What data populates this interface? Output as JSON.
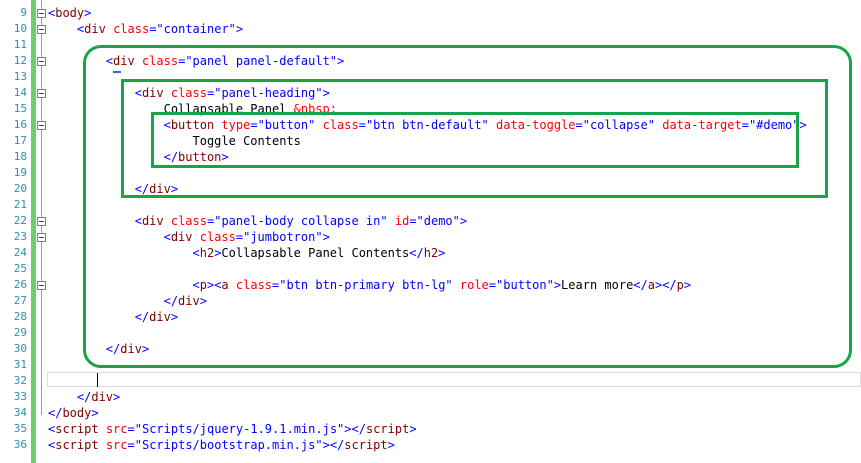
{
  "editor": {
    "line_numbers": [
      "9",
      "10",
      "11",
      "12",
      "13",
      "14",
      "15",
      "16",
      "17",
      "18",
      "19",
      "20",
      "21",
      "22",
      "23",
      "24",
      "25",
      "26",
      "27",
      "28",
      "29",
      "30",
      "31",
      "32",
      "33",
      "34",
      "35",
      "36"
    ],
    "lines": [
      {
        "n": "9",
        "parts": [
          [
            "p",
            "<"
          ],
          [
            "t",
            "body"
          ],
          [
            "p",
            ">"
          ]
        ]
      },
      {
        "n": "10",
        "parts": [
          [
            "x",
            "    "
          ],
          [
            "p",
            "<"
          ],
          [
            "t",
            "div"
          ],
          [
            "x",
            " "
          ],
          [
            "a",
            "class"
          ],
          [
            "p",
            "="
          ],
          [
            "v",
            "\"container\""
          ],
          [
            "p",
            ">"
          ]
        ]
      },
      {
        "n": "11",
        "parts": []
      },
      {
        "n": "12",
        "parts": [
          [
            "x",
            "        "
          ],
          [
            "p",
            "<"
          ],
          [
            "t",
            "div"
          ],
          [
            "x",
            " "
          ],
          [
            "a",
            "class"
          ],
          [
            "p",
            "="
          ],
          [
            "v",
            "\"panel panel-default\""
          ],
          [
            "p",
            ">"
          ]
        ]
      },
      {
        "n": "13",
        "parts": []
      },
      {
        "n": "14",
        "parts": [
          [
            "x",
            "            "
          ],
          [
            "p",
            "<"
          ],
          [
            "t",
            "div"
          ],
          [
            "x",
            " "
          ],
          [
            "a",
            "class"
          ],
          [
            "p",
            "="
          ],
          [
            "v",
            "\"panel-heading\""
          ],
          [
            "p",
            ">"
          ]
        ]
      },
      {
        "n": "15",
        "parts": [
          [
            "x",
            "                Collapsable Panel "
          ],
          [
            "e",
            "&nbsp;"
          ]
        ]
      },
      {
        "n": "16",
        "parts": [
          [
            "x",
            "                "
          ],
          [
            "p",
            "<"
          ],
          [
            "t",
            "button"
          ],
          [
            "x",
            " "
          ],
          [
            "a",
            "type"
          ],
          [
            "p",
            "="
          ],
          [
            "v",
            "\"button\""
          ],
          [
            "x",
            " "
          ],
          [
            "a",
            "class"
          ],
          [
            "p",
            "="
          ],
          [
            "v",
            "\"btn btn-default\""
          ],
          [
            "x",
            " "
          ],
          [
            "a",
            "data-toggle"
          ],
          [
            "p",
            "="
          ],
          [
            "v",
            "\"collapse\""
          ],
          [
            "x",
            " "
          ],
          [
            "a",
            "data-target"
          ],
          [
            "p",
            "="
          ],
          [
            "v",
            "\"#demo\""
          ],
          [
            "p",
            ">"
          ]
        ]
      },
      {
        "n": "17",
        "parts": [
          [
            "x",
            "                    Toggle Contents"
          ]
        ]
      },
      {
        "n": "18",
        "parts": [
          [
            "x",
            "                "
          ],
          [
            "p",
            "</"
          ],
          [
            "t",
            "button"
          ],
          [
            "p",
            ">"
          ]
        ]
      },
      {
        "n": "19",
        "parts": []
      },
      {
        "n": "20",
        "parts": [
          [
            "x",
            "            "
          ],
          [
            "p",
            "</"
          ],
          [
            "t",
            "div"
          ],
          [
            "p",
            ">"
          ]
        ]
      },
      {
        "n": "21",
        "parts": []
      },
      {
        "n": "22",
        "parts": [
          [
            "x",
            "            "
          ],
          [
            "p",
            "<"
          ],
          [
            "t",
            "div"
          ],
          [
            "x",
            " "
          ],
          [
            "a",
            "class"
          ],
          [
            "p",
            "="
          ],
          [
            "v",
            "\"panel-body collapse in\""
          ],
          [
            "x",
            " "
          ],
          [
            "a",
            "id"
          ],
          [
            "p",
            "="
          ],
          [
            "v",
            "\"demo\""
          ],
          [
            "p",
            ">"
          ]
        ]
      },
      {
        "n": "23",
        "parts": [
          [
            "x",
            "                "
          ],
          [
            "p",
            "<"
          ],
          [
            "t",
            "div"
          ],
          [
            "x",
            " "
          ],
          [
            "a",
            "class"
          ],
          [
            "p",
            "="
          ],
          [
            "v",
            "\"jumbotron\""
          ],
          [
            "p",
            ">"
          ]
        ]
      },
      {
        "n": "24",
        "parts": [
          [
            "x",
            "                    "
          ],
          [
            "p",
            "<"
          ],
          [
            "t",
            "h2"
          ],
          [
            "p",
            ">"
          ],
          [
            "x",
            "Collapsable Panel Contents"
          ],
          [
            "p",
            "</"
          ],
          [
            "t",
            "h2"
          ],
          [
            "p",
            ">"
          ]
        ]
      },
      {
        "n": "25",
        "parts": []
      },
      {
        "n": "26",
        "parts": [
          [
            "x",
            "                    "
          ],
          [
            "p",
            "<"
          ],
          [
            "t",
            "p"
          ],
          [
            "p",
            "><"
          ],
          [
            "t",
            "a"
          ],
          [
            "x",
            " "
          ],
          [
            "a",
            "class"
          ],
          [
            "p",
            "="
          ],
          [
            "v",
            "\"btn btn-primary btn-lg\""
          ],
          [
            "x",
            " "
          ],
          [
            "a",
            "role"
          ],
          [
            "p",
            "="
          ],
          [
            "v",
            "\"button\""
          ],
          [
            "p",
            ">"
          ],
          [
            "x",
            "Learn more"
          ],
          [
            "p",
            "</"
          ],
          [
            "t",
            "a"
          ],
          [
            "p",
            "></"
          ],
          [
            "t",
            "p"
          ],
          [
            "p",
            ">"
          ]
        ]
      },
      {
        "n": "27",
        "parts": [
          [
            "x",
            "                "
          ],
          [
            "p",
            "</"
          ],
          [
            "t",
            "div"
          ],
          [
            "p",
            ">"
          ]
        ]
      },
      {
        "n": "28",
        "parts": [
          [
            "x",
            "            "
          ],
          [
            "p",
            "</"
          ],
          [
            "t",
            "div"
          ],
          [
            "p",
            ">"
          ]
        ]
      },
      {
        "n": "29",
        "parts": []
      },
      {
        "n": "30",
        "parts": [
          [
            "x",
            "        "
          ],
          [
            "p",
            "</"
          ],
          [
            "t",
            "div"
          ],
          [
            "p",
            ">"
          ]
        ]
      },
      {
        "n": "31",
        "parts": []
      },
      {
        "n": "32",
        "parts": []
      },
      {
        "n": "33",
        "parts": [
          [
            "x",
            "    "
          ],
          [
            "p",
            "</"
          ],
          [
            "t",
            "div"
          ],
          [
            "p",
            ">"
          ]
        ]
      },
      {
        "n": "34",
        "parts": [
          [
            "p",
            "</"
          ],
          [
            "t",
            "body"
          ],
          [
            "p",
            ">"
          ]
        ]
      },
      {
        "n": "35",
        "parts": [
          [
            "p",
            "<"
          ],
          [
            "t",
            "script"
          ],
          [
            "x",
            " "
          ],
          [
            "a",
            "src"
          ],
          [
            "p",
            "="
          ],
          [
            "v",
            "\"Scripts/jquery-1.9.1.min.js\""
          ],
          [
            "p",
            "></"
          ],
          [
            "t",
            "script"
          ],
          [
            "p",
            ">"
          ]
        ]
      },
      {
        "n": "36",
        "parts": [
          [
            "p",
            "<"
          ],
          [
            "t",
            "script"
          ],
          [
            "x",
            " "
          ],
          [
            "a",
            "src"
          ],
          [
            "p",
            "="
          ],
          [
            "v",
            "\"Scripts/bootstrap.min.js\""
          ],
          [
            "p",
            "></"
          ],
          [
            "t",
            "script"
          ],
          [
            "p",
            ">"
          ]
        ]
      }
    ]
  },
  "colors": {
    "tag": "#800000",
    "attr": "#ff0000",
    "value": "#0000ff",
    "punct": "#0000ff",
    "entity": "#ff0000",
    "line_number": "#2b91af",
    "highlight": "#1aa34a",
    "change_bar": "#6ccf6c"
  }
}
